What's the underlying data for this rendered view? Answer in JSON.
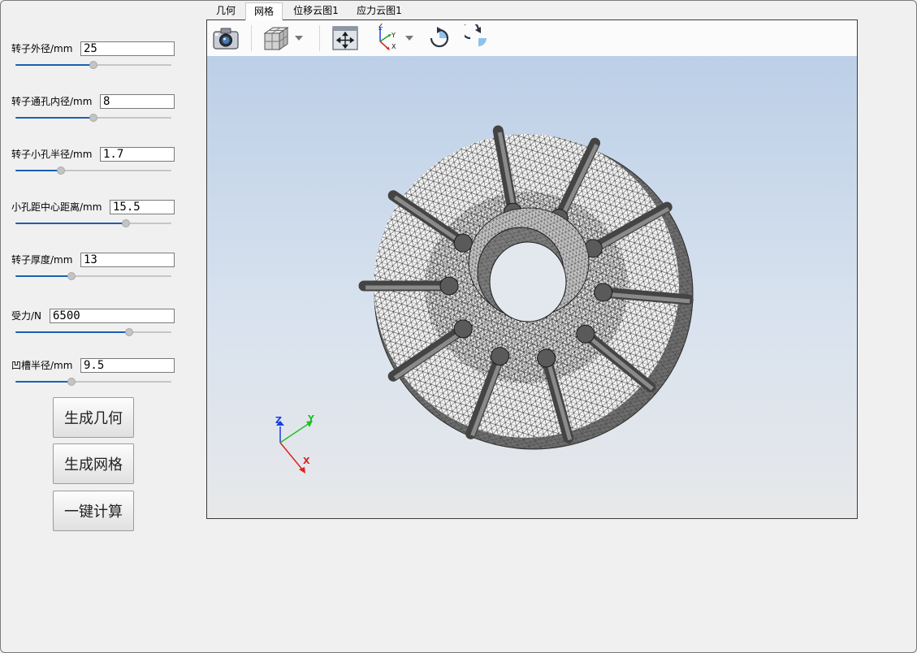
{
  "params": [
    {
      "label": "转子外径/mm",
      "value": "25",
      "slider": 0.5
    },
    {
      "label": "转子通孔内径/mm",
      "value": "8",
      "slider": 0.5
    },
    {
      "label": "转子小孔半径/mm",
      "value": "1.7",
      "slider": 0.29
    },
    {
      "label": "小孔距中心距离/mm",
      "value": "15.5",
      "slider": 0.71
    },
    {
      "label": "转子厚度/mm",
      "value": "13",
      "slider": 0.36
    },
    {
      "label": "受力/N",
      "value": "6500",
      "slider": 0.73
    },
    {
      "label": "凹槽半径/mm",
      "value": "9.5",
      "slider": 0.36
    }
  ],
  "buttons": {
    "generate_geometry": "生成几何",
    "generate_mesh": "生成网格",
    "one_click_compute": "一键计算"
  },
  "tabs": [
    "几何",
    "网格",
    "位移云图1",
    "应力云图1"
  ],
  "active_tab": "网格",
  "toolbar": {
    "icons": [
      "camera-icon",
      "view-cube-icon",
      "dropdown-arrow-icon",
      "fit-all-icon",
      "axes-orientation-icon",
      "dropdown-arrow-icon",
      "rotate-clockwise-icon",
      "rotate-counterclockwise-icon"
    ]
  },
  "triad": {
    "x": "X",
    "y": "Y",
    "z": "Z"
  },
  "colors": {
    "slider_fill": "#1a5fb4",
    "viewport_top": "#bccfe7",
    "viewport_bottom": "#e7e8ea",
    "axis_x": "#e02020",
    "axis_y": "#20c020",
    "axis_z": "#1a3ee0"
  }
}
